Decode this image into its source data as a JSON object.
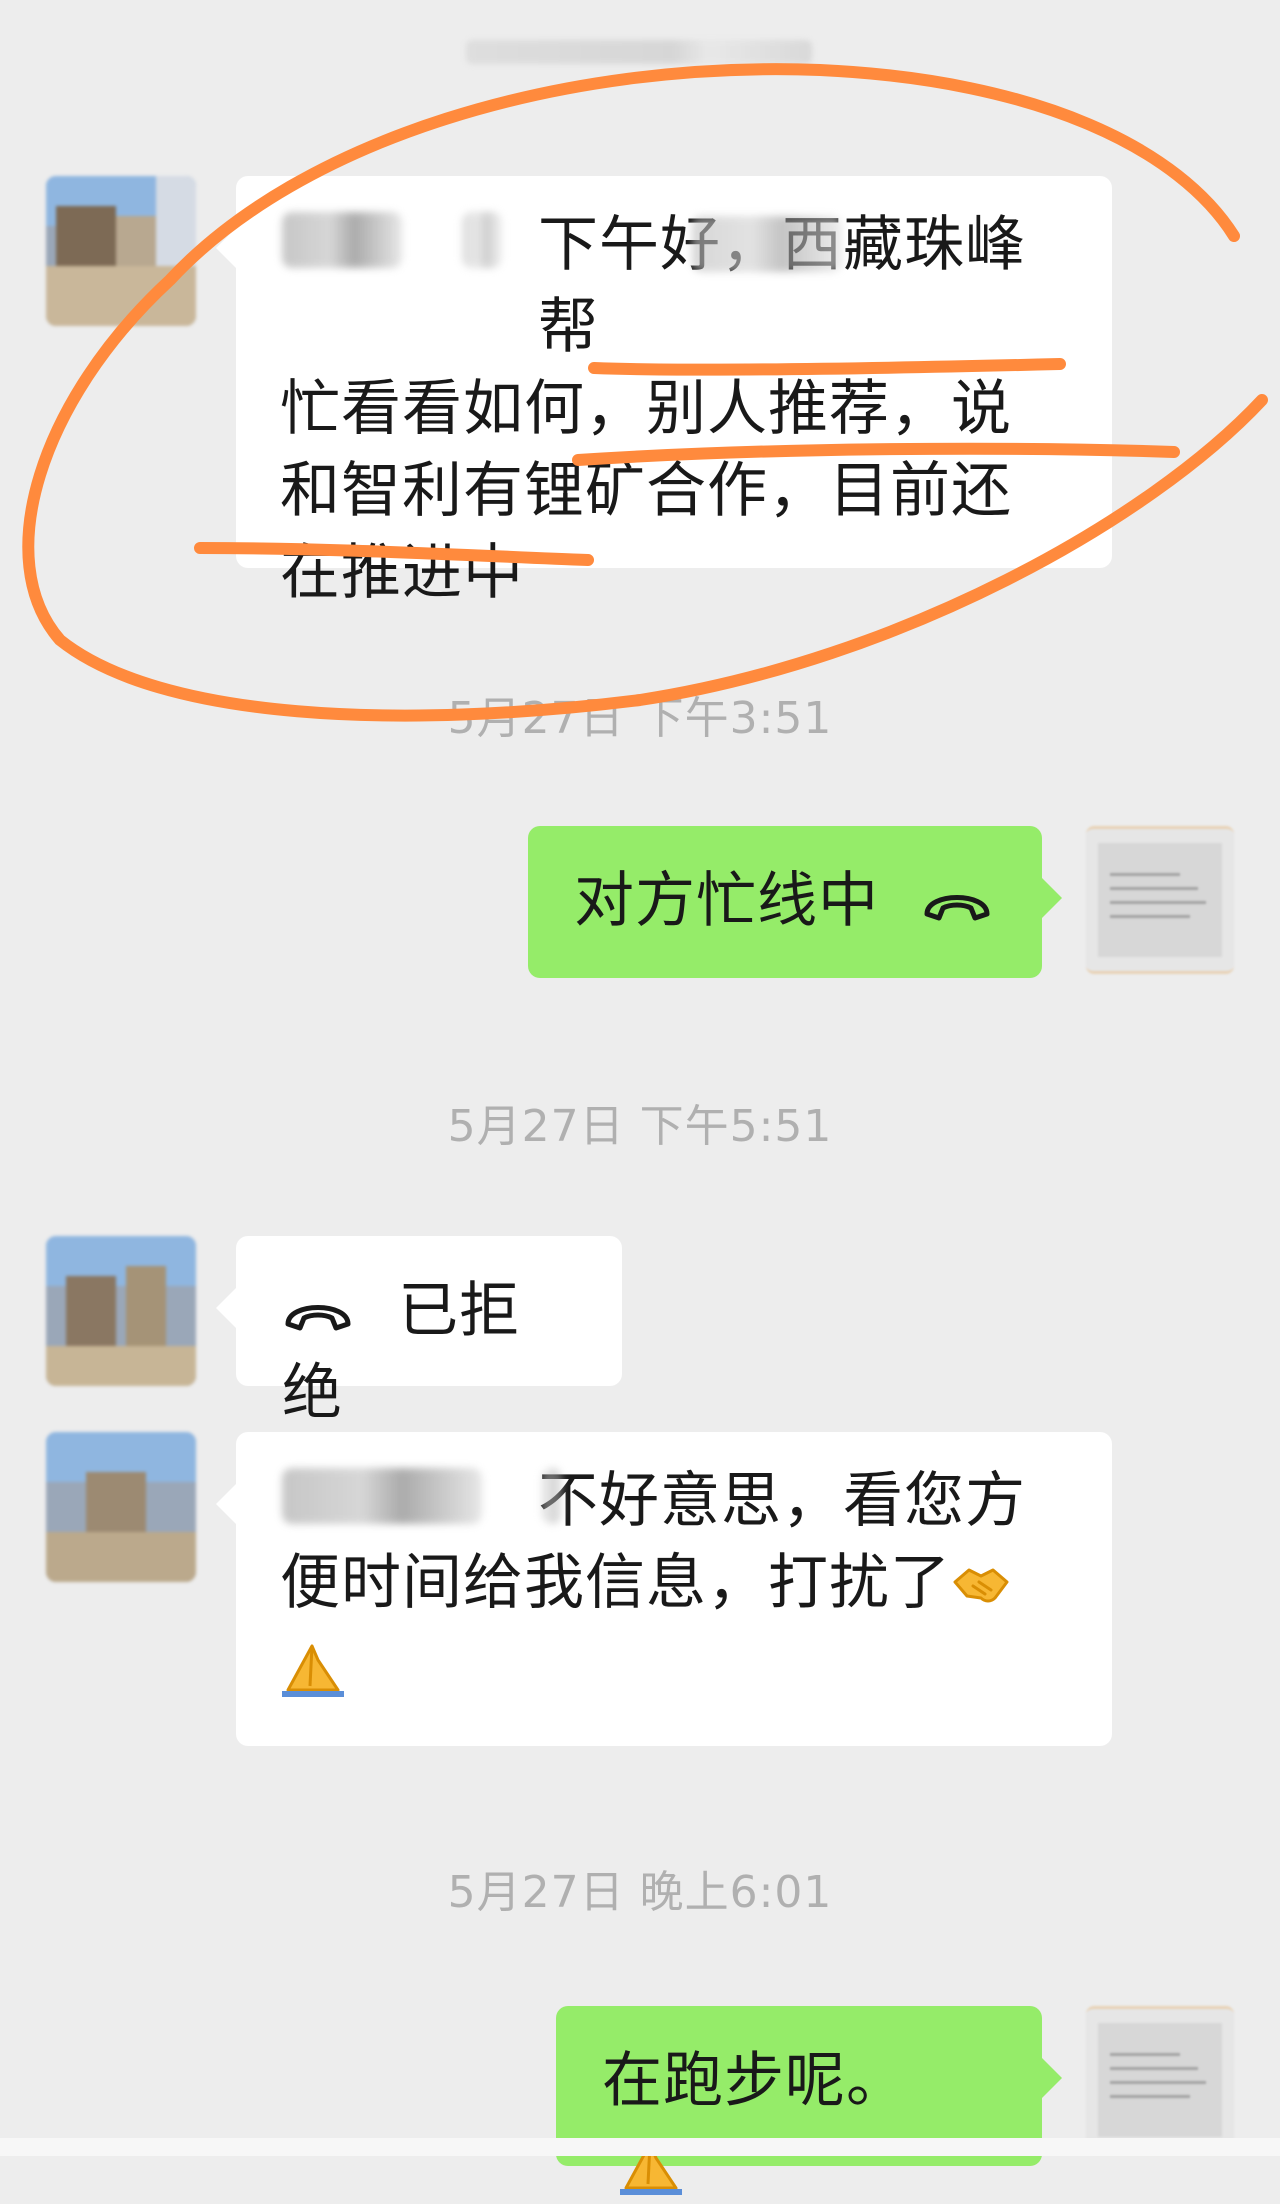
{
  "messages": [
    {
      "id": "m1",
      "direction": "incoming",
      "text": "下午好，西藏珠峰帮忙看看如何，别人推荐，说和智利有锂矿合作，目前还在推进中",
      "lines": [
        "下午好，西藏珠峰帮",
        "忙看看如何，别人推荐，说",
        "和智利有锂矿合作，目前还",
        "在推进中"
      ]
    },
    {
      "id": "t1",
      "type": "timestamp",
      "text": "5月27日 下午3:51"
    },
    {
      "id": "m2",
      "direction": "outgoing",
      "type": "call",
      "text": "对方忙线中",
      "icon": "phone-hangup-icon"
    },
    {
      "id": "t2",
      "type": "timestamp",
      "text": "5月27日 下午5:51"
    },
    {
      "id": "m3",
      "direction": "incoming",
      "type": "call",
      "text": "已拒绝",
      "icon": "phone-hangup-icon"
    },
    {
      "id": "m4",
      "direction": "incoming",
      "text": "不好意思，看您方便时间给我信息，打扰了🤝🙏",
      "lines": [
        "不好意思，看您方",
        "便时间给我信息，打扰了"
      ],
      "emojis": [
        "handshake",
        "folded-hands"
      ]
    },
    {
      "id": "t3",
      "type": "timestamp",
      "text": "5月27日 晚上6:01"
    },
    {
      "id": "m5",
      "direction": "outgoing",
      "text": "在跑步呢。",
      "emojis": [
        "folded-hands"
      ]
    }
  ],
  "colors": {
    "background": "#ededed",
    "incoming_bubble": "#ffffff",
    "outgoing_bubble": "#95ec69",
    "timestamp_text": "#b0b0b0",
    "annotation": "#ff8a3d"
  }
}
